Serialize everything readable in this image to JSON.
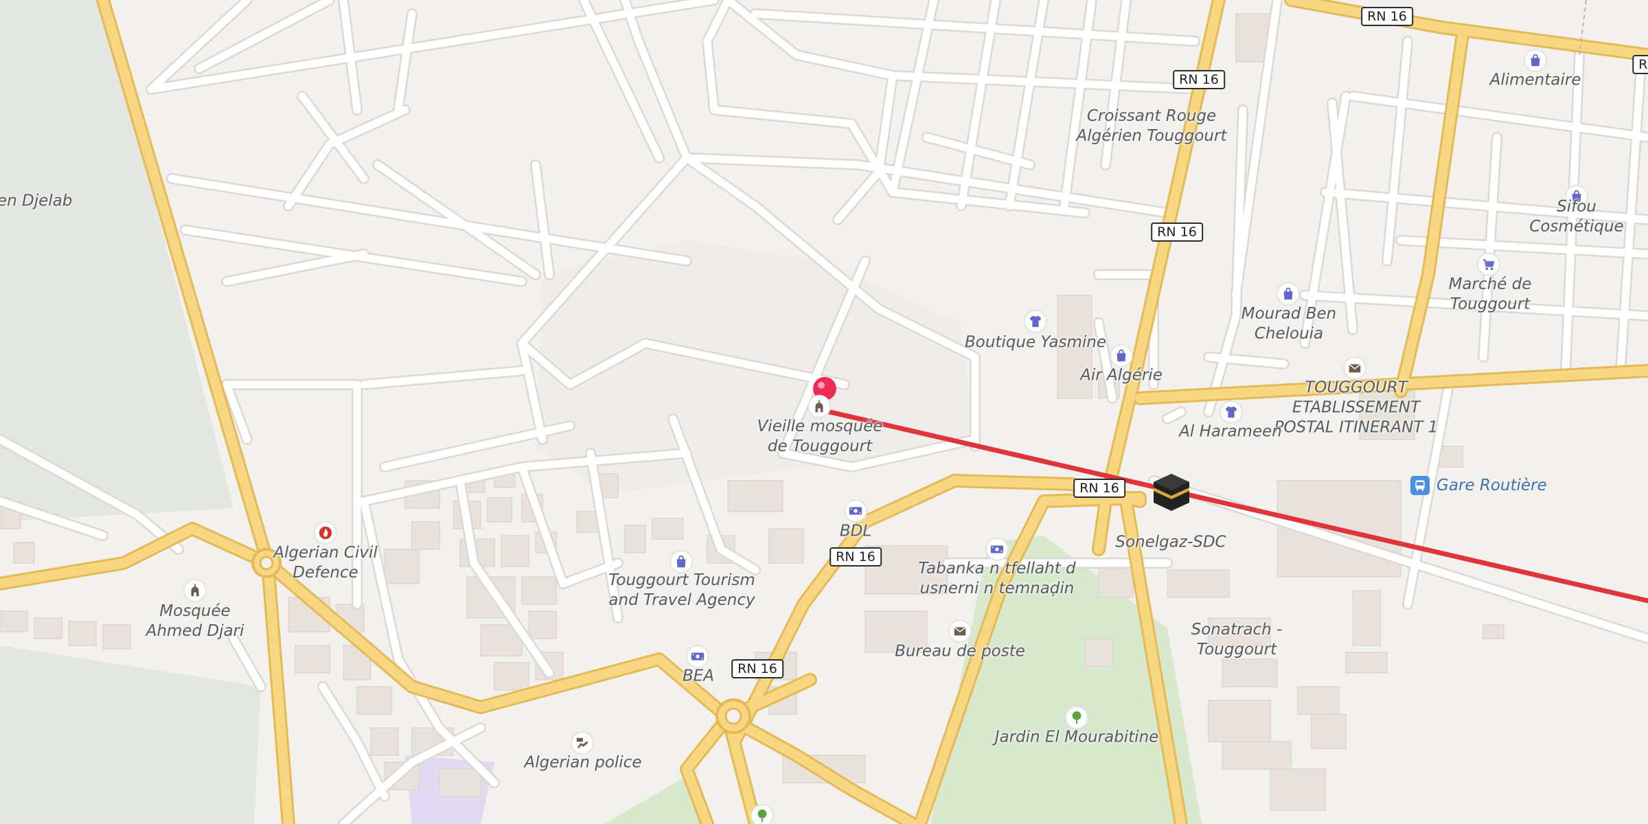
{
  "colors": {
    "background": "#f3f1ee",
    "minor_road": "#ffffff",
    "minor_road_casing": "#dcd8d3",
    "major_road": "#f7d782",
    "major_road_casing": "#e4b956",
    "park": "#d7e8cc",
    "large_area": "#e3e6e1",
    "building": "#e9e2dc",
    "route_line": "#e0343a",
    "pin": "#ee2a55",
    "poi_blue": "#6265c9",
    "poi_brown": "#6f5b50",
    "poi_red": "#d93326",
    "poi_green": "#5ba33f"
  },
  "map": {
    "road_shields": [
      "RN 16",
      "RN 16",
      "RN 16",
      "RN 16",
      "RN 16",
      "RN 16",
      "RN"
    ],
    "labels": [
      {
        "text": "en Djelab",
        "icon": "none"
      },
      {
        "text": "Croissant Rouge\nAlgérien Touggourt",
        "icon": "none"
      },
      {
        "text": "Alimentaire",
        "icon": "shopping-bag-icon"
      },
      {
        "text": "Sifou Cosmétique",
        "icon": "shopping-bag-icon"
      },
      {
        "text": "Marché de\nTouggourt",
        "icon": "shopping-cart-icon"
      },
      {
        "text": "Mourad Ben\nChelouia",
        "icon": "shopping-bag-icon"
      },
      {
        "text": "Boutique Yasmine",
        "icon": "clothes-icon"
      },
      {
        "text": "Air Algérie",
        "icon": "shopping-bag-icon"
      },
      {
        "text": "TOUGGOURT\nETABLISSEMENT\nPOSTAL ITINERANT 1",
        "icon": "mail-icon"
      },
      {
        "text": "Al Harameen",
        "icon": "clothes-icon"
      },
      {
        "text": "Vieille mosquée\nde Touggourt",
        "icon": "mosque-icon"
      },
      {
        "text": "BDL",
        "icon": "bank-icon"
      },
      {
        "text": "Tabanka n tfellaht d\nusnerni n temnaḍin",
        "icon": "bank-icon"
      },
      {
        "text": "Sonelgaz-SDC",
        "icon": "none"
      },
      {
        "text": "Sonatrach -\nTouggourt",
        "icon": "none"
      },
      {
        "text": "Algerian Civil\nDefence",
        "icon": "fire-station-icon"
      },
      {
        "text": "Mosquée\nAhmed Djari",
        "icon": "mosque-icon"
      },
      {
        "text": "Touggourt Tourism\nand Travel Agency",
        "icon": "shopping-bag-icon"
      },
      {
        "text": "BEA",
        "icon": "bank-icon"
      },
      {
        "text": "Bureau de poste",
        "icon": "mail-icon"
      },
      {
        "text": "Algerian police",
        "icon": "police-icon"
      },
      {
        "text": "Jardin El Mourabitine",
        "icon": "park-tree-icon"
      }
    ],
    "bus_station": {
      "text": "Gare Routière",
      "icon": "bus-icon"
    },
    "markers": {
      "pin": "location-pin-icon",
      "destination": "kaaba-icon"
    }
  }
}
